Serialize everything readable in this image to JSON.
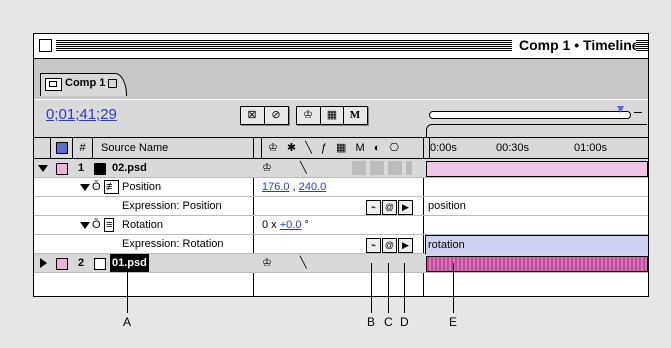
{
  "window": {
    "title": "Comp 1 • Timeline"
  },
  "tab": {
    "label": "Comp 1"
  },
  "toolbar": {
    "timecode": "0;01;41;29",
    "btn_m": "M"
  },
  "header": {
    "hash": "#",
    "source_name": "Source Name",
    "ticks": [
      "0:00s",
      "00:30s",
      "01:00s"
    ]
  },
  "layers": [
    {
      "num": "1",
      "name": "02.psd",
      "swatch_color": "#f0b0dc"
    },
    {
      "num": "2",
      "name": "01.psd",
      "swatch_color": "#f0b0dc"
    }
  ],
  "properties": {
    "position_label": "Position",
    "position_value_x": "176.0",
    "position_sep": " , ",
    "position_value_y": "240.0",
    "expr_position_label": "Expression: Position",
    "expr_position_text": "position",
    "rotation_label": "Rotation",
    "rotation_prefix": "0 x ",
    "rotation_value": "+0.0",
    "rotation_suffix": " °",
    "expr_rotation_label": "Expression: Rotation",
    "expr_rotation_text": "rotation"
  },
  "callouts": [
    "A",
    "B",
    "C",
    "D",
    "E"
  ]
}
